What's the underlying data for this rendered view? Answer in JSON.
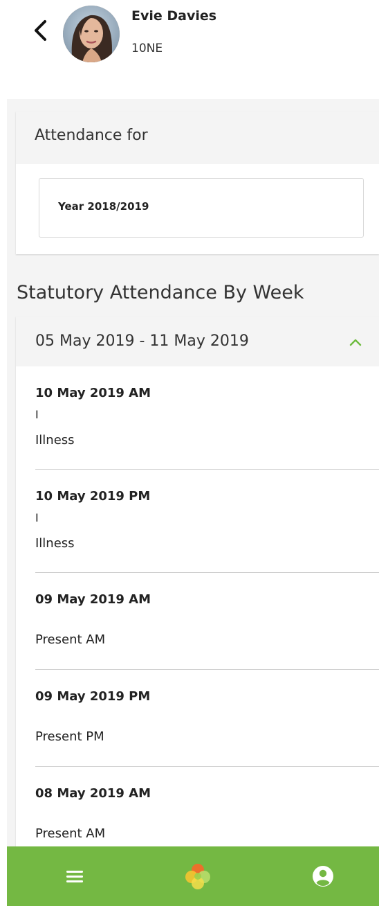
{
  "header": {
    "student_name": "Evie Davies",
    "student_class": "10NE",
    "back_icon": "chevron-left-icon",
    "avatar": "student-avatar-photo"
  },
  "attendance_for": {
    "title": "Attendance for",
    "selected_year": "Year 2018/2019"
  },
  "section": {
    "heading": "Statutory Attendance By Week"
  },
  "week": {
    "range": "05 May 2019 - 11 May 2019",
    "expanded": true,
    "chevron_icon": "chevron-up-icon",
    "entries": [
      {
        "date": "10 May 2019 AM",
        "code": "I",
        "description": "Illness"
      },
      {
        "date": "10 May 2019 PM",
        "code": "I",
        "description": "Illness"
      },
      {
        "date": "09 May 2019 AM",
        "code": "",
        "description": "Present AM"
      },
      {
        "date": "09 May 2019 PM",
        "code": "",
        "description": "Present PM"
      },
      {
        "date": "08 May 2019 AM",
        "code": "",
        "description": "Present AM"
      }
    ]
  },
  "bottom_nav": {
    "items": [
      {
        "icon": "menu-icon"
      },
      {
        "icon": "app-logo-icon"
      },
      {
        "icon": "account-icon"
      }
    ]
  },
  "colors": {
    "accent_green": "#74b843",
    "chevron_green": "#6dbb3f",
    "panel_gray": "#f4f4f4"
  }
}
